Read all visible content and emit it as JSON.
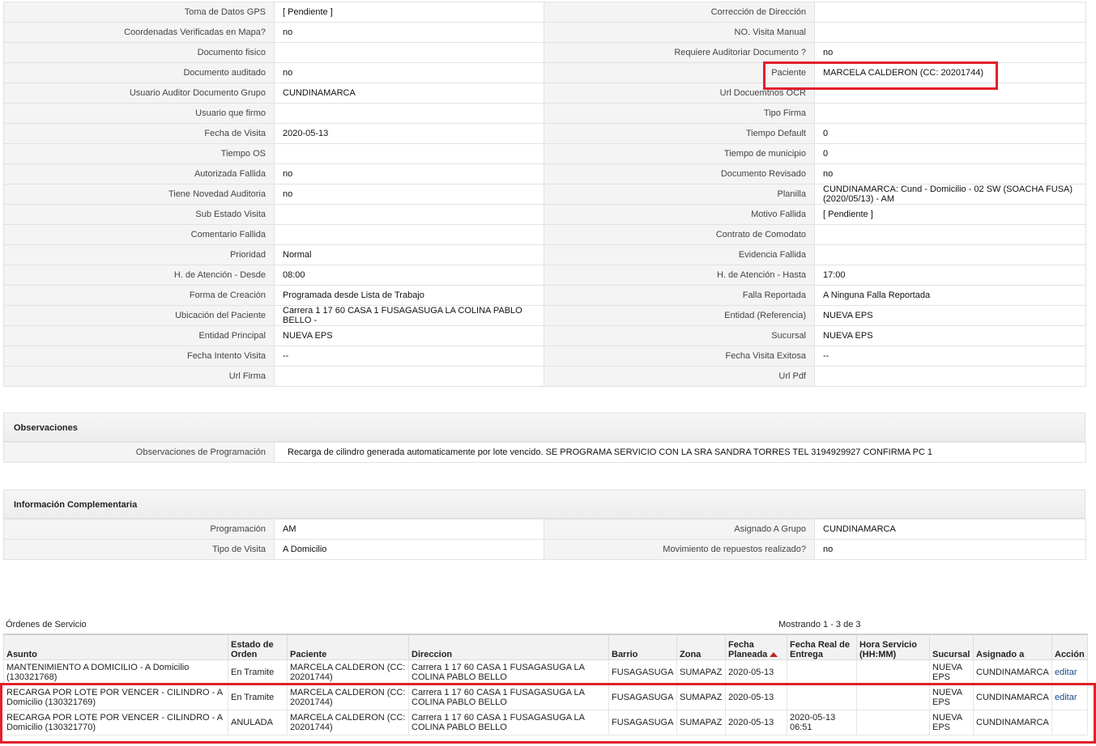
{
  "details": {
    "rows": [
      {
        "l1": "Toma de Datos GPS",
        "v1": "[ Pendiente ]",
        "l2": "Corrección de Dirección",
        "v2": ""
      },
      {
        "l1": "Coordenadas Verificadas en Mapa?",
        "v1": "no",
        "l2": "NO. Visita Manual",
        "v2": ""
      },
      {
        "l1": "Documento fisico",
        "v1": "",
        "l2": "Requiere Auditoriar Documento ?",
        "v2": "no"
      },
      {
        "l1": "Documento auditado",
        "v1": "no",
        "l2": "Paciente",
        "v2": "MARCELA CALDERON (CC: 20201744)"
      },
      {
        "l1": "Usuario Auditor Documento Grupo",
        "v1": "CUNDINAMARCA",
        "l2": "Url Docuemtnos OCR",
        "v2": ""
      },
      {
        "l1": "Usuario que firmo",
        "v1": "",
        "l2": "Tipo Firma",
        "v2": ""
      },
      {
        "l1": "Fecha de Visita",
        "v1": "2020-05-13",
        "l2": "Tiempo Default",
        "v2": "0"
      },
      {
        "l1": "Tiempo OS",
        "v1": "",
        "l2": "Tiempo de municipio",
        "v2": "0"
      },
      {
        "l1": "Autorizada Fallida",
        "v1": "no",
        "l2": "Documento Revisado",
        "v2": "no"
      },
      {
        "l1": "Tiene Novedad Auditoria",
        "v1": "no",
        "l2": "Planilla",
        "v2": "CUNDINAMARCA: Cund - Domicilio - 02 SW (SOACHA FUSA) (2020/05/13) - AM"
      },
      {
        "l1": "Sub Estado Visita",
        "v1": "",
        "l2": "Motivo Fallida",
        "v2": "[ Pendiente ]"
      },
      {
        "l1": "Comentario Fallida",
        "v1": "",
        "l2": "Contrato de Comodato",
        "v2": ""
      },
      {
        "l1": "Prioridad",
        "v1": "Normal",
        "l2": "Evidencia Fallida",
        "v2": ""
      },
      {
        "l1": "H. de Atención - Desde",
        "v1": "08:00",
        "l2": "H. de Atención - Hasta",
        "v2": "17:00"
      },
      {
        "l1": "Forma de Creación",
        "v1": "Programada desde Lista de Trabajo",
        "l2": "Falla Reportada",
        "v2": "A Ninguna Falla Reportada"
      },
      {
        "l1": "Ubicación del Paciente",
        "v1": "Carrera 1 17 60 CASA 1 FUSAGASUGA LA COLINA PABLO BELLO -",
        "l2": "Entidad (Referencia)",
        "v2": "NUEVA EPS"
      },
      {
        "l1": "Entidad Principal",
        "v1": "NUEVA EPS",
        "l2": "Sucursal",
        "v2": "NUEVA EPS"
      },
      {
        "l1": "Fecha Intento Visita",
        "v1": "--",
        "l2": "Fecha Visita Exitosa",
        "v2": "--"
      },
      {
        "l1": "Url Firma",
        "v1": "",
        "l2": "Url Pdf",
        "v2": ""
      }
    ]
  },
  "observaciones": {
    "title": "Observaciones",
    "label": "Observaciones de Programación",
    "value": "Recarga de cilindro generada automaticamente por lote vencido. SE PROGRAMA SERVICIO CON LA SRA SANDRA TORRES TEL 3194929927 CONFIRMA PC 1"
  },
  "complementaria": {
    "title": "Información Complementaria",
    "rows": [
      {
        "l1": "Programación",
        "v1": "AM",
        "l2": "Asignado A Grupo",
        "v2": "CUNDINAMARCA"
      },
      {
        "l1": "Tipo de Visita",
        "v1": "A Domicilio",
        "l2": "Movimiento de repuestos realizado?",
        "v2": "no"
      }
    ]
  },
  "ordenes": {
    "title": "Órdenes de Servicio",
    "count": "Mostrando 1 - 3 de 3",
    "headers": [
      "Asunto",
      "Estado de Orden",
      "Paciente",
      "Direccion",
      "Barrio",
      "Zona",
      "Fecha Planeada",
      "Fecha Real de Entrega",
      "Hora Servicio (HH:MM)",
      "Sucursal",
      "Asignado a",
      "Acción"
    ],
    "rows": [
      {
        "asunto": "MANTENIMIENTO A DOMICILIO - A Domicilio (130321768)",
        "estado": "En Tramite",
        "paciente": "MARCELA CALDERON (CC: 20201744)",
        "direccion": "Carrera 1 17 60 CASA 1 FUSAGASUGA LA COLINA PABLO BELLO",
        "barrio": "FUSAGASUGA",
        "zona": "SUMAPAZ",
        "fecha_planeada": "2020-05-13",
        "fecha_real": "",
        "hora": "",
        "sucursal": "NUEVA EPS",
        "asignado": "CUNDINAMARCA",
        "accion": "editar"
      },
      {
        "asunto": "RECARGA POR LOTE POR VENCER - CILINDRO - A Domicilio (130321769)",
        "estado": "En Tramite",
        "paciente": "MARCELA CALDERON (CC: 20201744)",
        "direccion": "Carrera 1 17 60 CASA 1 FUSAGASUGA LA COLINA PABLO BELLO",
        "barrio": "FUSAGASUGA",
        "zona": "SUMAPAZ",
        "fecha_planeada": "2020-05-13",
        "fecha_real": "",
        "hora": "",
        "sucursal": "NUEVA EPS",
        "asignado": "CUNDINAMARCA",
        "accion": "editar"
      },
      {
        "asunto": "RECARGA POR LOTE POR VENCER - CILINDRO - A Domicilio (130321770)",
        "estado": "ANULADA",
        "paciente": "MARCELA CALDERON (CC: 20201744)",
        "direccion": "Carrera 1 17 60 CASA 1 FUSAGASUGA LA COLINA PABLO BELLO",
        "barrio": "FUSAGASUGA",
        "zona": "SUMAPAZ",
        "fecha_planeada": "2020-05-13",
        "fecha_real": "2020-05-13 06:51",
        "hora": "",
        "sucursal": "NUEVA EPS",
        "asignado": "CUNDINAMARCA",
        "accion": ""
      }
    ]
  },
  "colors": {
    "highlight": "#e0202a",
    "link": "#1a4a8a",
    "sort_arrow": "#c0261f"
  }
}
